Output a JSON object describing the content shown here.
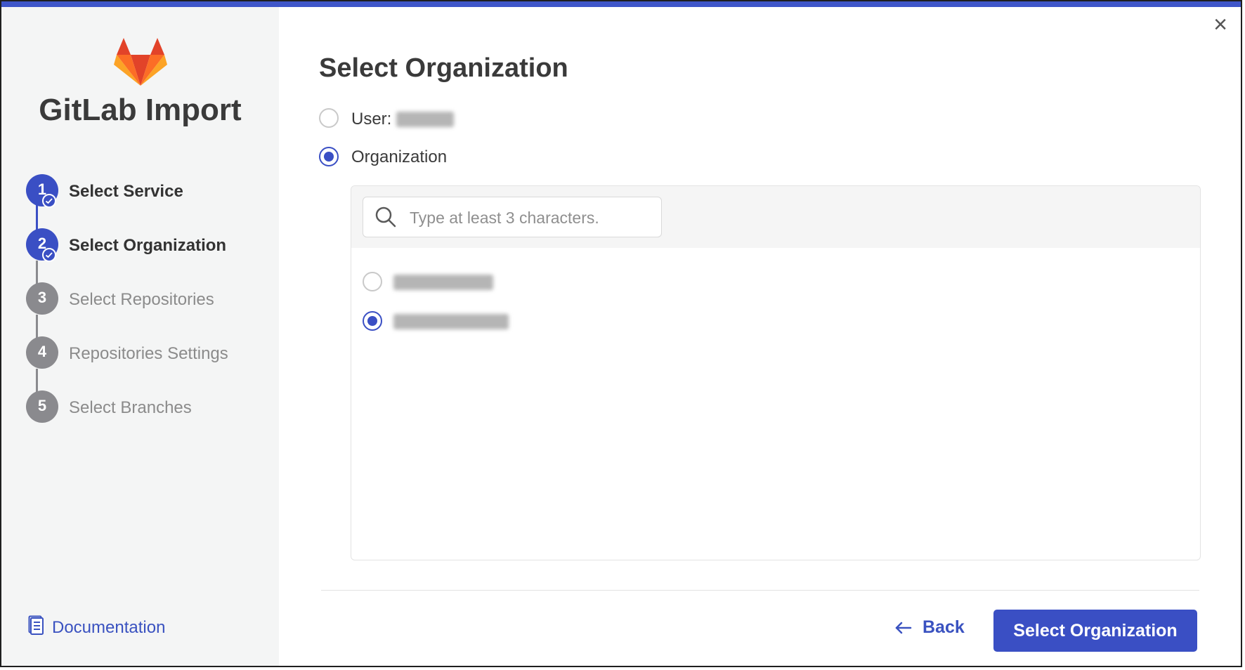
{
  "sidebar": {
    "title": "GitLab Import",
    "steps": [
      {
        "number": "1",
        "label": "Select Service",
        "state": "done"
      },
      {
        "number": "2",
        "label": "Select Organization",
        "state": "done"
      },
      {
        "number": "3",
        "label": "Select Repositories",
        "state": "todo"
      },
      {
        "number": "4",
        "label": "Repositories Settings",
        "state": "todo"
      },
      {
        "number": "5",
        "label": "Select Branches",
        "state": "todo"
      }
    ],
    "documentation_label": "Documentation"
  },
  "main": {
    "title": "Select Organization",
    "options": {
      "user_label": "User:",
      "user_selected": false,
      "organization_label": "Organization",
      "organization_selected": true
    },
    "search": {
      "placeholder": "Type at least 3 characters."
    },
    "organizations": [
      {
        "selected": false
      },
      {
        "selected": true
      }
    ]
  },
  "footer": {
    "back_label": "Back",
    "primary_label": "Select Organization"
  },
  "colors": {
    "accent": "#3a4fc4",
    "top_bar": "#3f56c9",
    "sidebar_bg": "#f4f5f5",
    "inactive_step": "#8a8a8e"
  }
}
